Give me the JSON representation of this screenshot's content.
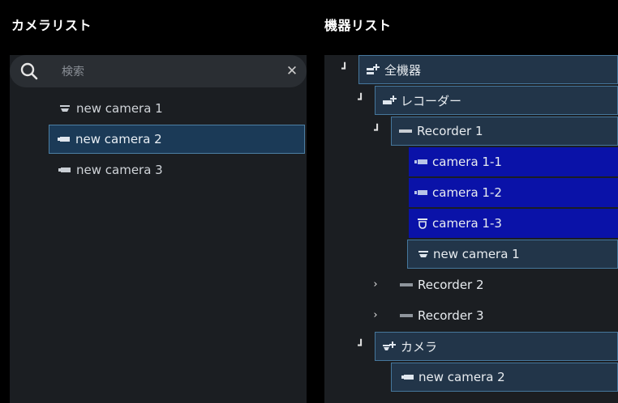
{
  "left_panel": {
    "title": "カメラリスト",
    "search": {
      "placeholder": "検索",
      "value": ""
    },
    "cameras": [
      {
        "label": "new camera 1",
        "icon": "dome-camera-icon",
        "selected": false
      },
      {
        "label": "new camera 2",
        "icon": "box-camera-icon",
        "selected": true
      },
      {
        "label": "new camera 3",
        "icon": "box-camera-icon",
        "selected": false
      }
    ]
  },
  "right_panel": {
    "title": "機器リスト",
    "tree": {
      "all_devices": "全機器",
      "recorders_group": "レコーダー",
      "recorder1": "Recorder 1",
      "camera_1_1": "camera 1-1",
      "camera_1_2": "camera 1-2",
      "camera_1_3": "camera 1-3",
      "recorder1_new_camera": "new camera 1",
      "recorder2": "Recorder 2",
      "recorder3": "Recorder 3",
      "cameras_group": "カメラ",
      "cameras_group_item": "new camera 2"
    }
  },
  "colors": {
    "background": "#000000",
    "panel": "#1b1e22",
    "selected_bg": "#1b3a57",
    "selected_border": "#4c7fa3",
    "highlight_blue": "#0a12a8"
  }
}
